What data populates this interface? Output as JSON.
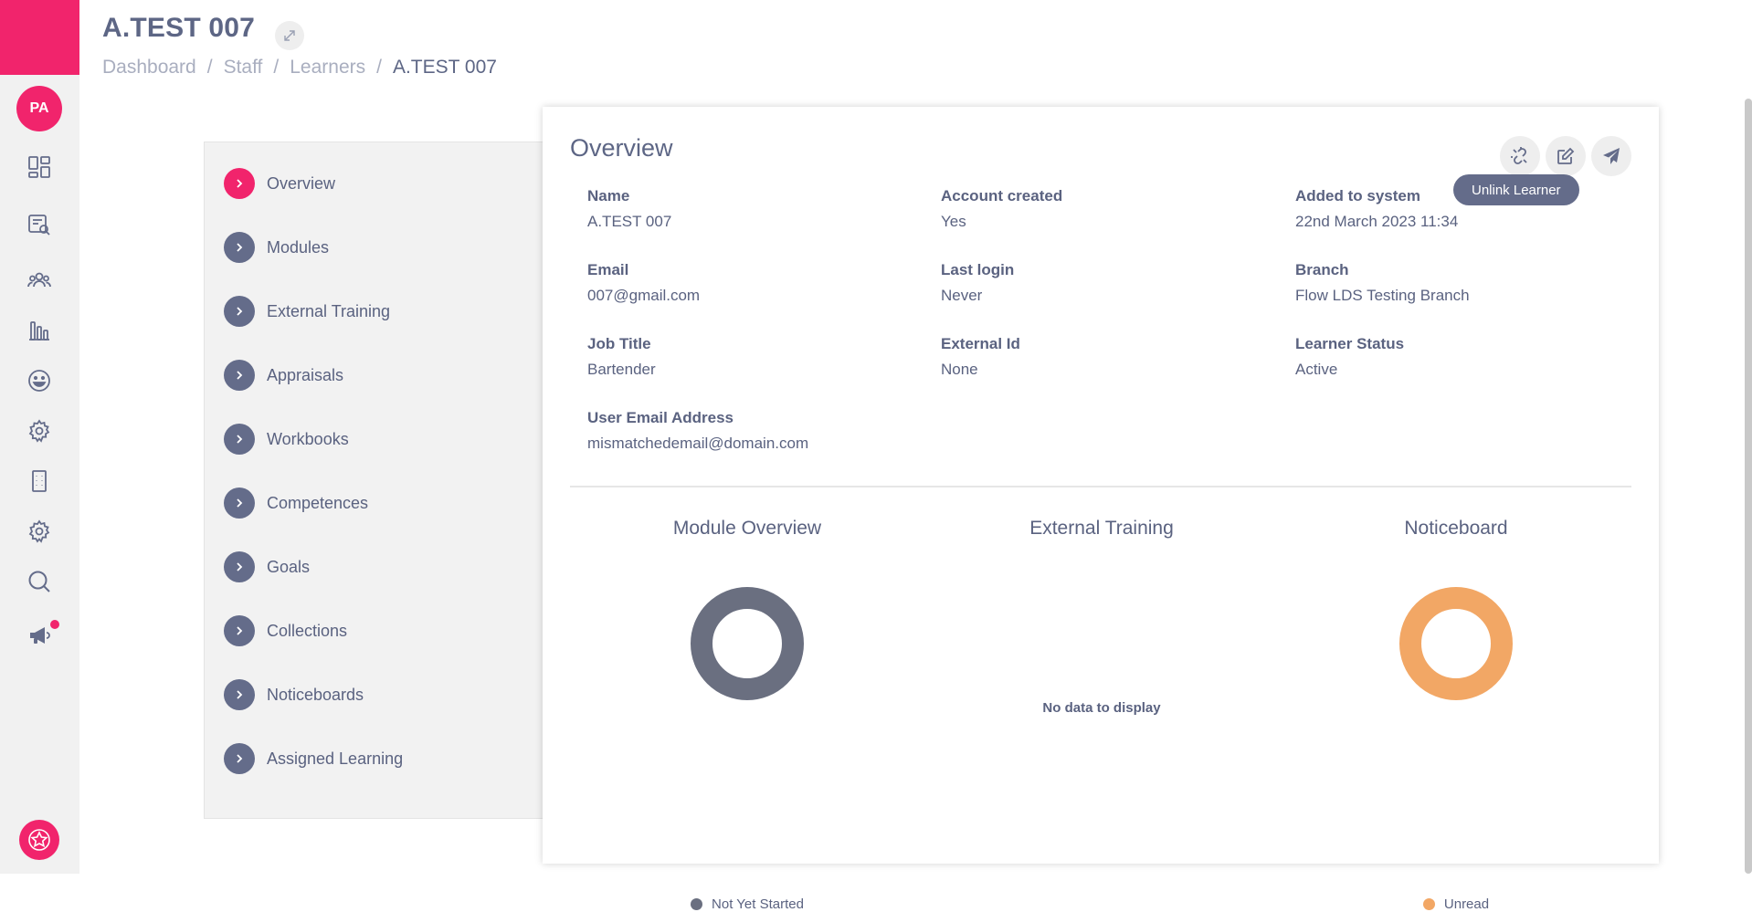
{
  "header": {
    "title": "A.TEST 007",
    "breadcrumb": [
      "Dashboard",
      "Staff",
      "Learners",
      "A.TEST 007"
    ]
  },
  "user": {
    "initials": "PA"
  },
  "rail_icons": [
    "dashboard-icon",
    "search-list-icon",
    "users-icon",
    "bar-chart-icon",
    "smile-icon",
    "gear-icon",
    "building-icon",
    "gear-icon",
    "search-icon",
    "megaphone-icon"
  ],
  "menu": {
    "items": [
      {
        "label": "Overview",
        "active": true
      },
      {
        "label": "Modules"
      },
      {
        "label": "External Training"
      },
      {
        "label": "Appraisals"
      },
      {
        "label": "Workbooks"
      },
      {
        "label": "Competences"
      },
      {
        "label": "Goals"
      },
      {
        "label": "Collections"
      },
      {
        "label": "Noticeboards"
      },
      {
        "label": "Assigned Learning"
      }
    ]
  },
  "overview": {
    "title": "Overview",
    "tooltip": "Unlink Learner",
    "fields": [
      {
        "label": "Name",
        "value": "A.TEST 007"
      },
      {
        "label": "Account created",
        "value": "Yes"
      },
      {
        "label": "Added to system",
        "value": "22nd March 2023 11:34"
      },
      {
        "label": "Email",
        "value": "007@gmail.com"
      },
      {
        "label": "Last login",
        "value": "Never"
      },
      {
        "label": "Branch",
        "value": "Flow LDS Testing Branch"
      },
      {
        "label": "Job Title",
        "value": "Bartender"
      },
      {
        "label": "External Id",
        "value": "None"
      },
      {
        "label": "Learner Status",
        "value": "Active"
      },
      {
        "label": "User Email Address",
        "value": "mismatchedemail@domain.com"
      }
    ],
    "charts": [
      {
        "title": "Module Overview",
        "legend": "Not Yet Started",
        "color": "#6a6f80",
        "value": 100
      },
      {
        "title": "External Training",
        "no_data": "No data to display"
      },
      {
        "title": "Noticeboard",
        "legend": "Unread",
        "color": "#f2a765",
        "value": 100
      }
    ]
  },
  "colors": {
    "accent": "#f1246c",
    "chevron": "#646c8a",
    "text": "#5a6280"
  }
}
